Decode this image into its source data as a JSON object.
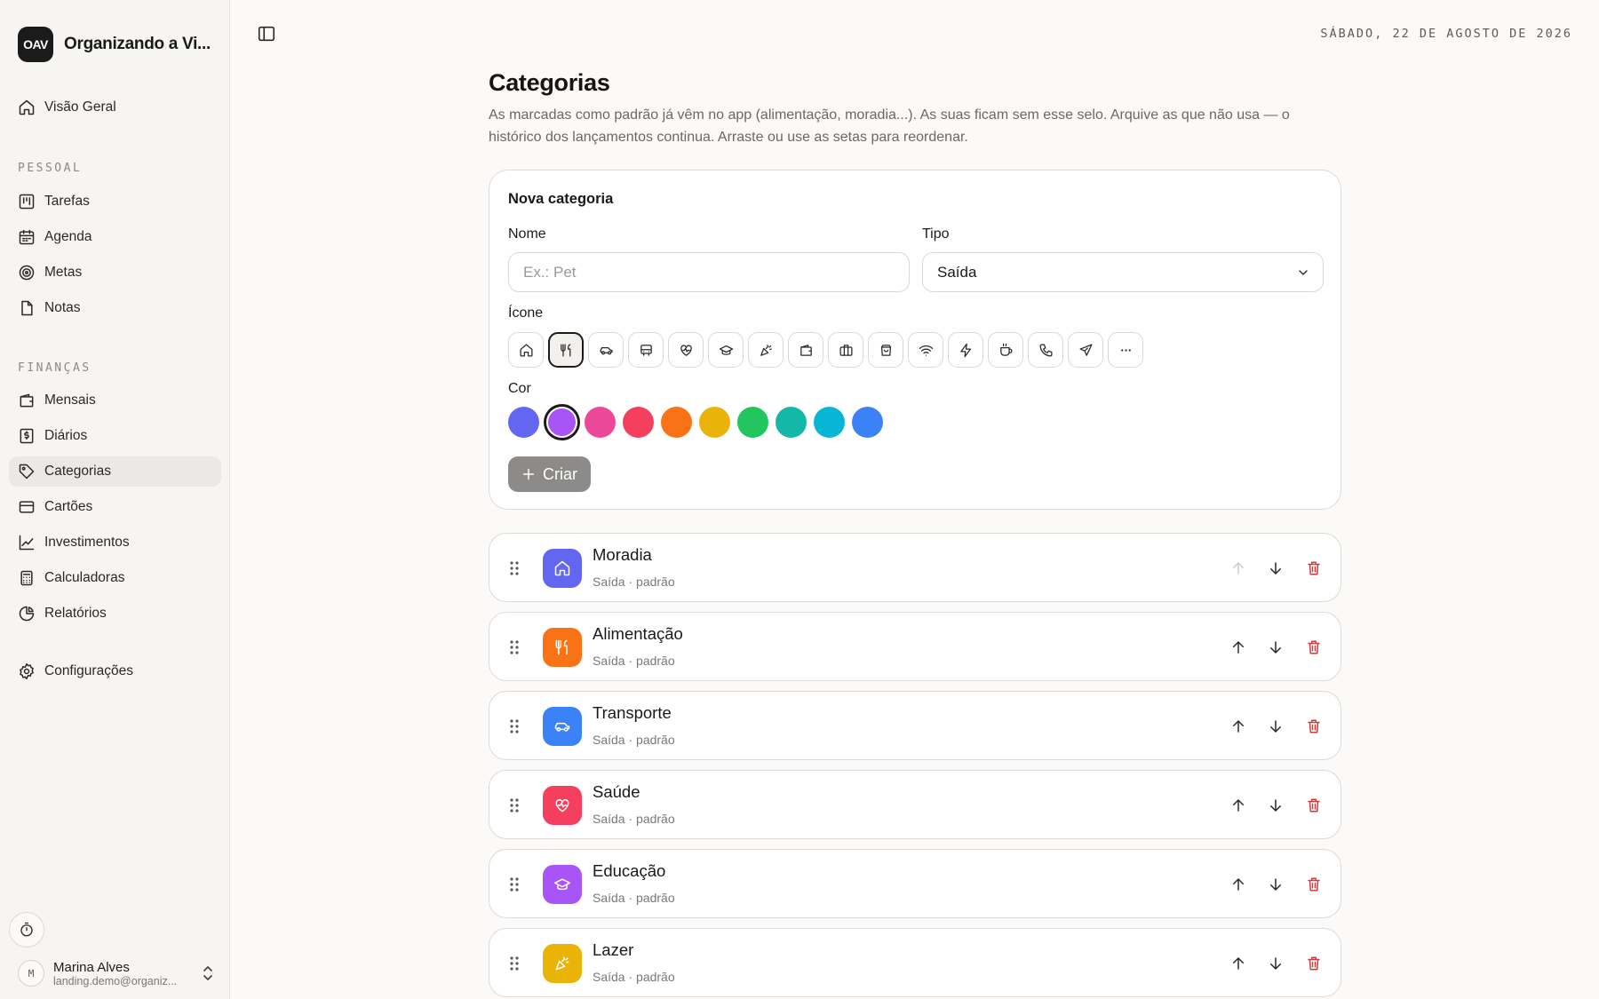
{
  "brand": {
    "logo": "OAV",
    "name": "Organizando a Vi..."
  },
  "nav": {
    "overview": "Visão Geral",
    "section_personal": "PESSOAL",
    "personal": [
      {
        "label": "Tarefas",
        "icon": "kanban-icon"
      },
      {
        "label": "Agenda",
        "icon": "calendar-icon"
      },
      {
        "label": "Metas",
        "icon": "target-icon"
      },
      {
        "label": "Notas",
        "icon": "note-icon"
      }
    ],
    "section_finance": "FINANÇAS",
    "finance": [
      {
        "label": "Mensais",
        "icon": "wallet-icon"
      },
      {
        "label": "Diários",
        "icon": "receipt-icon"
      },
      {
        "label": "Categorias",
        "icon": "tag-icon",
        "active": true
      },
      {
        "label": "Cartões",
        "icon": "card-icon"
      },
      {
        "label": "Investimentos",
        "icon": "chart-line-icon"
      },
      {
        "label": "Calculadoras",
        "icon": "calculator-icon"
      },
      {
        "label": "Relatórios",
        "icon": "pie-chart-icon"
      }
    ],
    "settings": "Configurações"
  },
  "user": {
    "initial": "M",
    "name": "Marina Alves",
    "email": "landing.demo@organiz..."
  },
  "header": {
    "date": "SÁBADO, 22 DE AGOSTO DE 2026"
  },
  "page": {
    "title": "Categorias",
    "description": "As marcadas como padrão já vêm no app (alimentação, moradia...). As suas ficam sem esse selo. Arquive as que não usa — o histórico dos lançamentos continua. Arraste ou use as setas para reordenar."
  },
  "new_category": {
    "title": "Nova categoria",
    "name_label": "Nome",
    "name_placeholder": "Ex.: Pet",
    "type_label": "Tipo",
    "type_value": "Saída",
    "icon_label": "Ícone",
    "icons": [
      "home-icon",
      "utensils-icon",
      "car-icon",
      "bus-icon",
      "heart-pulse-icon",
      "graduation-cap-icon",
      "party-icon",
      "wallet-icon",
      "briefcase-icon",
      "shopping-bag-icon",
      "wifi-icon",
      "zap-icon",
      "coffee-icon",
      "phone-icon",
      "plane-icon",
      "more-icon"
    ],
    "selected_icon": 1,
    "color_label": "Cor",
    "colors": [
      "#6366f1",
      "#a855f7",
      "#ec4899",
      "#f43f5e",
      "#f97316",
      "#eab308",
      "#22c55e",
      "#14b8a6",
      "#06b6d4",
      "#3b82f6"
    ],
    "selected_color": 1,
    "create_label": "Criar"
  },
  "categories": [
    {
      "name": "Moradia",
      "sub": "Saída · padrão",
      "color": "#6366f1",
      "icon": "home-icon",
      "up_disabled": true
    },
    {
      "name": "Alimentação",
      "sub": "Saída · padrão",
      "color": "#f97316",
      "icon": "utensils-icon"
    },
    {
      "name": "Transporte",
      "sub": "Saída · padrão",
      "color": "#3b82f6",
      "icon": "car-icon"
    },
    {
      "name": "Saúde",
      "sub": "Saída · padrão",
      "color": "#f43f5e",
      "icon": "heart-pulse-icon"
    },
    {
      "name": "Educação",
      "sub": "Saída · padrão",
      "color": "#a855f7",
      "icon": "graduation-cap-icon"
    },
    {
      "name": "Lazer",
      "sub": "Saída · padrão",
      "color": "#eab308",
      "icon": "party-icon"
    }
  ]
}
